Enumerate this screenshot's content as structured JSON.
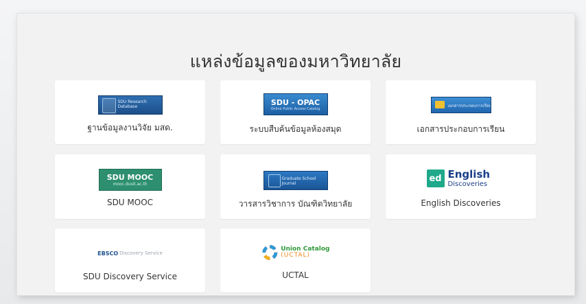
{
  "section": {
    "title": "แหล่งข้อมูลของมหาวิทยาลัย"
  },
  "cards": [
    {
      "label": "ฐานข้อมูลงานวิจัย มสด.",
      "logo": {
        "kind": "research",
        "icon": "research-database-logo"
      }
    },
    {
      "label": "ระบบสืบค้นข้อมูลห้องสมุด",
      "logo": {
        "kind": "opac",
        "icon": "library-catalog-logo",
        "line1": "SDU - OPAC",
        "line2": "Online Public Access Catalog"
      }
    },
    {
      "label": "เอกสารประกอบการเรียน",
      "logo": {
        "kind": "doc",
        "icon": "course-material-logo",
        "text": "เอกสารประกอบการเรียน"
      }
    },
    {
      "label": "SDU MOOC",
      "logo": {
        "kind": "mooc",
        "icon": "sdu-mooc-logo",
        "line1": "SDU MOOC",
        "line2": "mooc.dusit.ac.th"
      }
    },
    {
      "label": "วารสารวิชาการ บัณฑิตวิทยาลัย",
      "logo": {
        "kind": "journal",
        "icon": "journal-logo"
      }
    },
    {
      "label": "English Discoveries",
      "logo": {
        "kind": "eng",
        "icon": "english-discoveries-logo",
        "badge": "ed",
        "line1": "English",
        "line2": "Discoveries"
      }
    },
    {
      "label": "SDU Discovery Service",
      "logo": {
        "kind": "ebsco",
        "icon": "ebsco-logo",
        "brand": "EBSCO",
        "rest": "Discovery Service"
      }
    },
    {
      "label": "UCTAL",
      "logo": {
        "kind": "uctal",
        "icon": "union-catalog-logo",
        "line1": "Union Catalog",
        "line2": "(UCTAL)"
      }
    }
  ],
  "colors": {
    "panel": "#f2f2f2",
    "card": "#ffffff",
    "text": "#333333"
  }
}
